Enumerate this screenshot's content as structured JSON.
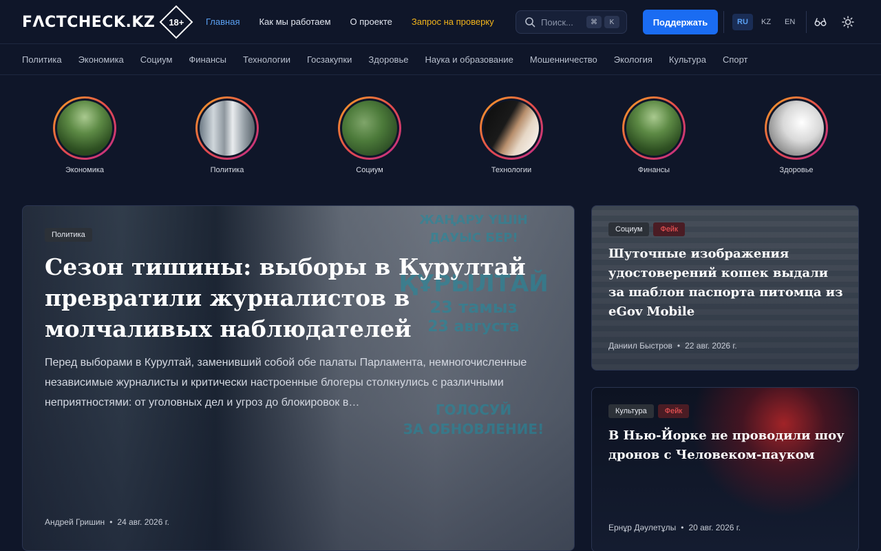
{
  "header": {
    "logo_text": "FΛCTCHECK.KZ",
    "age_badge": "18+",
    "nav": [
      {
        "label": "Главная",
        "active": true
      },
      {
        "label": "Как мы работаем"
      },
      {
        "label": "О проекте"
      },
      {
        "label": "Запрос на проверку"
      }
    ],
    "search_placeholder": "Поиск...",
    "search_shortcut": [
      "⌘",
      "K"
    ],
    "support_label": "Поддержать",
    "languages": [
      {
        "code": "RU",
        "active": true
      },
      {
        "code": "KZ"
      },
      {
        "code": "EN"
      }
    ],
    "icons": [
      "accessibility-glasses-icon",
      "theme-sun-icon"
    ],
    "colors": {
      "accent": "#1a6cf2",
      "active_nav": "#5aa0f2",
      "request_nav": "#f2b41b",
      "background": "#0f1629"
    }
  },
  "categories": [
    "Политика",
    "Экономика",
    "Социум",
    "Финансы",
    "Технологии",
    "Госзакупки",
    "Здоровье",
    "Наука и образование",
    "Мошенничество",
    "Экология",
    "Культура",
    "Спорт"
  ],
  "stories": [
    {
      "label": "Экономика",
      "image": "park"
    },
    {
      "label": "Политика",
      "image": "door"
    },
    {
      "label": "Социум",
      "image": "forest"
    },
    {
      "label": "Технологии",
      "image": "laptop"
    },
    {
      "label": "Финансы",
      "image": "park"
    },
    {
      "label": "Здоровье",
      "image": "pills"
    }
  ],
  "hero": {
    "tag": "Политика",
    "title": "Сезон тишины: выборы в Курултай превратили журналистов в молчаливых наблюдателей",
    "lead": "Перед выборами в Курултай, заменивший собой обе палаты Парламента, немногочисленные независимые журналисты и критически настроенные блогеры столкнулись с различными неприятностями: от уголовных дел и угроз до блокировок в…",
    "author": "Андрей Гришин",
    "date": "24 авг. 2026 г.",
    "banner_lines": [
      "ЖАҢАРУ ҮШІН",
      "ДАУЫС БЕР!",
      "ҚҰРЫЛТАЙ",
      "23 тамыз",
      "23 августа",
      "ГОЛОСУЙ",
      "ЗА ОБНОВЛЕНИЕ!"
    ]
  },
  "side_cards": [
    {
      "tags": [
        {
          "label": "Социум"
        },
        {
          "label": "Фейк",
          "fake": true
        }
      ],
      "title": "Шуточные изображения удостоверений кошек выдали за шаблон паспорта питомца из eGov Mobile",
      "author": "Даниил Быстров",
      "date": "22 авг. 2026 г."
    },
    {
      "tags": [
        {
          "label": "Культура"
        },
        {
          "label": "Фейк",
          "fake": true
        }
      ],
      "title": "В Нью-Йорке не проводили шоу дронов с Человеком-пауком",
      "author": "Ернұр Дәулетұлы",
      "date": "20 авг. 2026 г."
    }
  ]
}
